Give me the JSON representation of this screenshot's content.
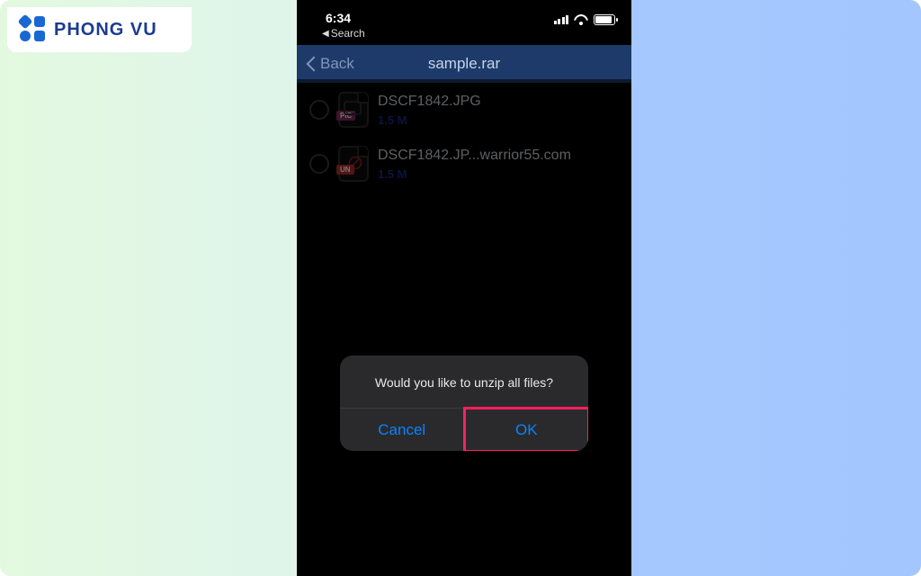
{
  "brand": {
    "name": "PHONG VU"
  },
  "status": {
    "time": "6:34",
    "sublabel": "Search"
  },
  "nav": {
    "back": "Back",
    "title": "sample.rar"
  },
  "files": [
    {
      "name": "DSCF1842.JPG",
      "size": "1.5 M",
      "tag": "PIC"
    },
    {
      "name": "DSCF1842.JP...warrior55.com",
      "size": "1.5 M",
      "tag": "UN"
    }
  ],
  "alert": {
    "message": "Would you like to unzip all files?",
    "cancel": "Cancel",
    "ok": "OK"
  }
}
